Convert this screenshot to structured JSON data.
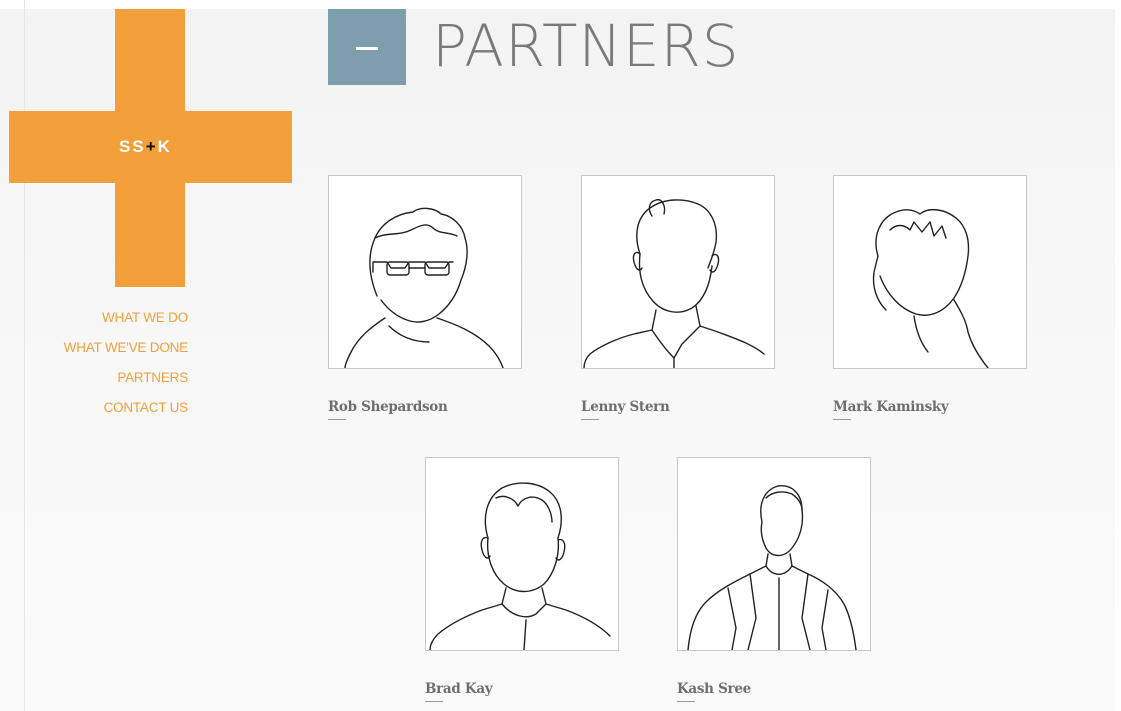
{
  "logo": {
    "text_left": "SS",
    "text_plus": "+",
    "text_right": "K",
    "color": "#f3a03b"
  },
  "nav": {
    "items": [
      {
        "label": "WHAT WE DO"
      },
      {
        "label": "WHAT WE'VE DONE"
      },
      {
        "label": "PARTNERS"
      },
      {
        "label": "CONTACT US"
      }
    ]
  },
  "page": {
    "title": "PARTNERS",
    "collapse_icon": "minus-icon",
    "accent": "#7f9ead"
  },
  "partners": [
    {
      "name": "Rob Shepardson",
      "icon": "portrait-sketch-icon"
    },
    {
      "name": "Lenny Stern",
      "icon": "portrait-sketch-icon"
    },
    {
      "name": "Mark Kaminsky",
      "icon": "portrait-sketch-icon"
    },
    {
      "name": "Brad Kay",
      "icon": "portrait-sketch-icon"
    },
    {
      "name": "Kash Sree",
      "icon": "portrait-sketch-icon"
    }
  ]
}
